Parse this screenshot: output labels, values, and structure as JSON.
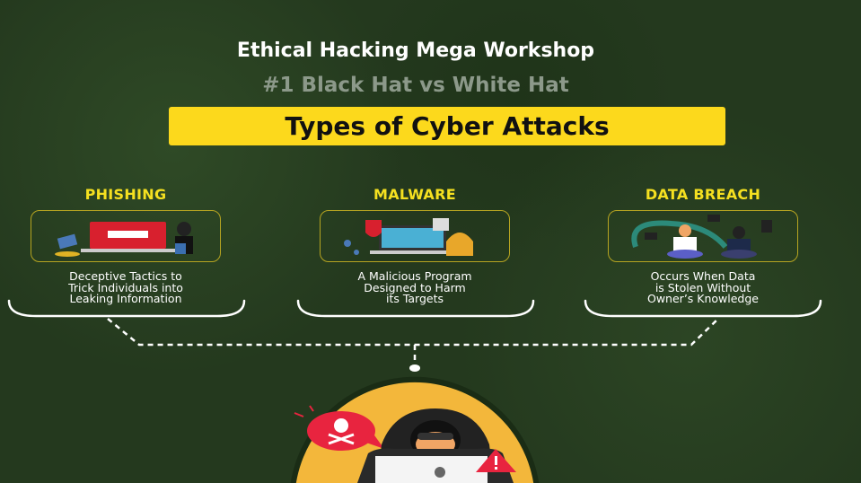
{
  "header": {
    "title": "Ethical Hacking Mega Workshop",
    "subtitle": "#1 Black Hat vs White Hat",
    "banner": "Types of Cyber Attacks"
  },
  "attacks": [
    {
      "title": "PHISHING",
      "desc": [
        "Deceptive Tactics to",
        "Trick Individuals into",
        "Leaking Information"
      ]
    },
    {
      "title": "MALWARE",
      "desc": [
        "A Malicious Program",
        "Designed to Harm",
        "its Targets"
      ]
    },
    {
      "title": "DATA BREACH",
      "desc": [
        "Occurs When Data",
        "is Stolen Without",
        "Owner’s Knowledge"
      ]
    }
  ],
  "colors": {
    "accent": "#fcd91c",
    "background": "#24391e",
    "circle": "#f3b73b",
    "alert": "#e8243f"
  }
}
